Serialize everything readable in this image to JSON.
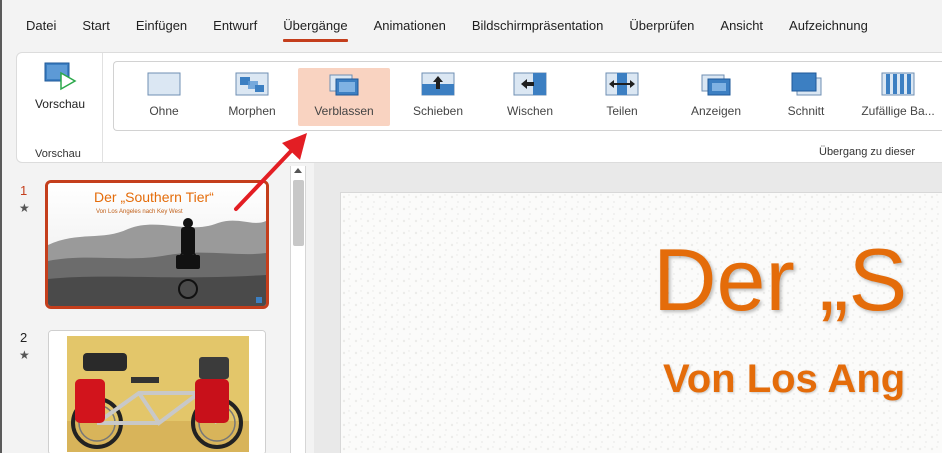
{
  "menu": {
    "tabs": [
      {
        "label": "Datei"
      },
      {
        "label": "Start"
      },
      {
        "label": "Einfügen"
      },
      {
        "label": "Entwurf"
      },
      {
        "label": "Übergänge"
      },
      {
        "label": "Animationen"
      },
      {
        "label": "Bildschirmpräsentation"
      },
      {
        "label": "Überprüfen"
      },
      {
        "label": "Ansicht"
      },
      {
        "label": "Aufzeichnung"
      }
    ],
    "active": "Übergänge"
  },
  "ribbon": {
    "preview_button": "Vorschau",
    "preview_group": "Vorschau",
    "transitions_group": "Übergang zu dieser",
    "transitions": [
      {
        "label": "Ohne",
        "icon": "none-icon"
      },
      {
        "label": "Morphen",
        "icon": "morph-icon"
      },
      {
        "label": "Verblassen",
        "icon": "fade-icon",
        "selected": true
      },
      {
        "label": "Schieben",
        "icon": "push-icon"
      },
      {
        "label": "Wischen",
        "icon": "wipe-icon"
      },
      {
        "label": "Teilen",
        "icon": "split-icon"
      },
      {
        "label": "Anzeigen",
        "icon": "reveal-icon"
      },
      {
        "label": "Schnitt",
        "icon": "cut-icon"
      },
      {
        "label": "Zufällige Ba...",
        "icon": "random-bars-icon"
      }
    ]
  },
  "slides": [
    {
      "number": "1",
      "marker": "★",
      "title": "Der „Southern Tier“",
      "subtitle": "Von Los Angeles nach Key West"
    },
    {
      "number": "2",
      "marker": "★"
    }
  ],
  "main_slide": {
    "title": "Der „S",
    "subtitle": "Von Los Ang"
  },
  "colors": {
    "accent": "#c43e1c",
    "title_orange": "#e46c0a",
    "selected_tile": "#f9d3c1",
    "annotation_arrow": "#e31e24"
  }
}
